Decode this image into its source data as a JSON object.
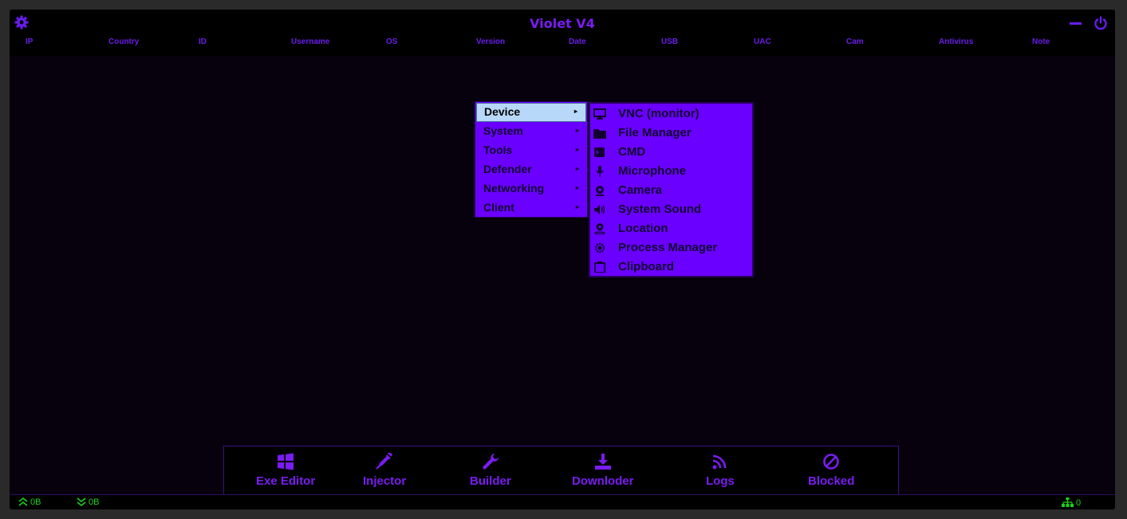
{
  "window": {
    "title": "Violet V4",
    "accent_color": "#7a1cf2",
    "background": "#000000"
  },
  "titlebar_icons": {
    "settings": "gear-icon",
    "minimize": "minimize-icon",
    "close": "power-icon"
  },
  "columns": [
    "IP",
    "Country",
    "ID",
    "Username",
    "OS",
    "Version",
    "Date",
    "USB",
    "UAC",
    "Cam",
    "Antivirus",
    "Note"
  ],
  "context_menu": {
    "items": [
      {
        "label": "Device",
        "active": true,
        "arrow": "▸"
      },
      {
        "label": "System",
        "arrow": "▸"
      },
      {
        "label": "Tools",
        "arrow": "▸"
      },
      {
        "label": "Defender",
        "arrow": "▸"
      },
      {
        "label": "Networking",
        "arrow": "▸"
      },
      {
        "label": "Client",
        "arrow": "▸"
      }
    ],
    "submenu": [
      {
        "label": "VNC (monitor)",
        "icon": "monitor-icon"
      },
      {
        "label": "File Manager",
        "icon": "folder-icon"
      },
      {
        "label": "CMD",
        "icon": "terminal-icon"
      },
      {
        "label": "Microphone",
        "icon": "microphone-icon"
      },
      {
        "label": "Camera",
        "icon": "webcam-icon"
      },
      {
        "label": "System Sound",
        "icon": "speaker-icon"
      },
      {
        "label": "Location",
        "icon": "location-icon"
      },
      {
        "label": "Process Manager",
        "icon": "cog-icon"
      },
      {
        "label": "Clipboard",
        "icon": "clipboard-icon"
      }
    ]
  },
  "dock": [
    {
      "label": "Exe Editor",
      "icon": "windows-icon"
    },
    {
      "label": "Injector",
      "icon": "syringe-icon"
    },
    {
      "label": "Builder",
      "icon": "wrench-icon"
    },
    {
      "label": "Downloder",
      "icon": "download-icon"
    },
    {
      "label": "Logs",
      "icon": "rss-icon"
    },
    {
      "label": "Blocked",
      "icon": "ban-icon"
    }
  ],
  "status": {
    "upload": "0B",
    "download": "0B",
    "connections": "0",
    "color": "#18d418"
  }
}
